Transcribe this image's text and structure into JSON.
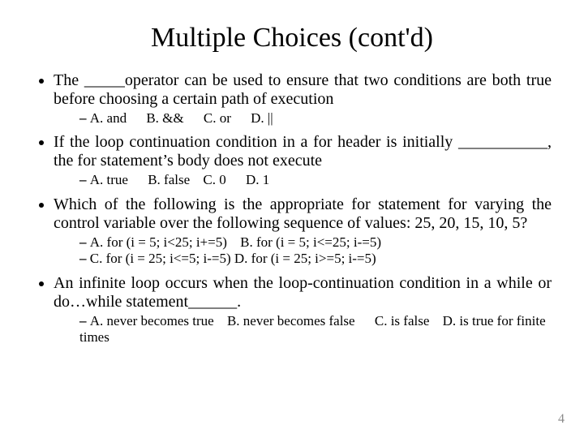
{
  "title": "Multiple Choices (cont'd)",
  "page_number": "4",
  "q1": {
    "text": "The _____operator can be used to ensure that two conditions are both true before choosing a certain path of execution",
    "a": "A. and",
    "b": "B. &&",
    "c": "C. or",
    "d": "D. ||"
  },
  "q2": {
    "text": "If the loop continuation condition in a for header is initially ___________, the for statement’s body does not execute",
    "a": "A. true",
    "b": "B. false",
    "c": "C. 0",
    "d": "D. 1"
  },
  "q3": {
    "text": "Which of the following is the appropriate for statement for varying the control variable over the following sequence of values: 25, 20, 15, 10, 5?",
    "line1a": "A. for (i = 5; i<25; i+=5)",
    "line1b": "B. for (i = 5; i<=25; i-=5)",
    "line2a": "C. for (i = 25; i<=5; i-=5)",
    "line2b": "D. for (i = 25; i>=5; i-=5)"
  },
  "q4": {
    "text": "An infinite loop occurs when the loop-continuation condition in a while or do…while statement______.",
    "a": "A. never becomes true",
    "b": "B. never becomes false",
    "c": "C. is false",
    "d": "D. is true for finite times"
  }
}
